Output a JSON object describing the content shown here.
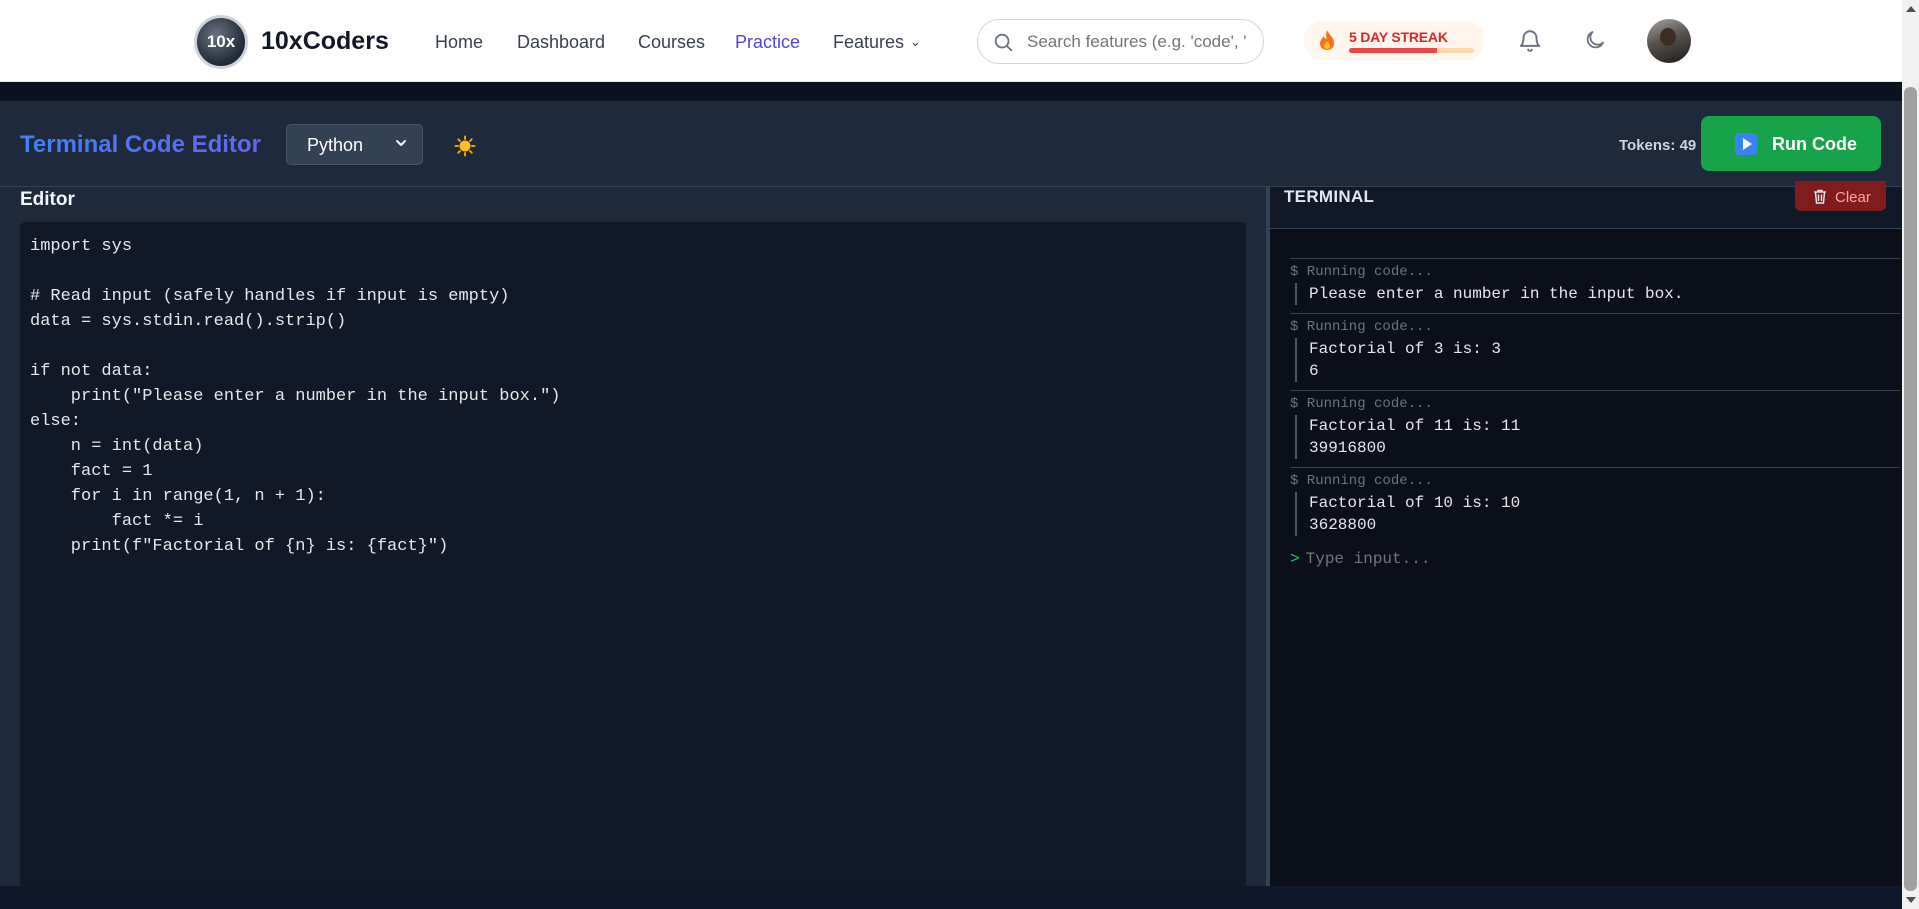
{
  "nav": {
    "logo_text": "10x",
    "brand": "10xCoders",
    "links": [
      {
        "label": "Home"
      },
      {
        "label": "Dashboard"
      },
      {
        "label": "Courses"
      },
      {
        "label": "Practice",
        "active": true
      },
      {
        "label": "Features",
        "has_dropdown": true
      }
    ],
    "search_placeholder": "Search features (e.g. 'code', '",
    "streak_label": "5 DAY STREAK",
    "streak_progress": 0.7,
    "icons": [
      "search-icon",
      "flame-icon",
      "bell-icon",
      "moon-icon",
      "avatar"
    ]
  },
  "toolbar": {
    "title": "Terminal Code Editor",
    "language": "Python",
    "tokens_label": "Tokens: 49",
    "run_label": "Run Code"
  },
  "editor": {
    "label": "Editor",
    "code": "import sys\n\n# Read input (safely handles if input is empty)\ndata = sys.stdin.read().strip()\n\nif not data:\n    print(\"Please enter a number in the input box.\")\nelse:\n    n = int(data)\n    fact = 1\n    for i in range(1, n + 1):\n        fact *= i\n    print(f\"Factorial of {n} is: {fact}\")"
  },
  "terminal": {
    "title": "TERMINAL",
    "clear_label": "Clear",
    "runs": [
      {
        "prompt": "$ Running code...",
        "output": "Please enter a number in the input box."
      },
      {
        "prompt": "$ Running code...",
        "output": "Factorial of 3 is: 3\n6"
      },
      {
        "prompt": "$ Running code...",
        "output": "Factorial of 11 is: 11\n39916800"
      },
      {
        "prompt": "$ Running code...",
        "output": "Factorial of 10 is: 10\n3628800"
      }
    ],
    "input_caret": ">",
    "input_placeholder": "Type input..."
  },
  "colors": {
    "accent": "#4f46e5",
    "run_button": "#16a34a",
    "clear_button": "#7f1d1d",
    "editor_bg": "#111827",
    "terminal_bg": "#0b0f19"
  }
}
